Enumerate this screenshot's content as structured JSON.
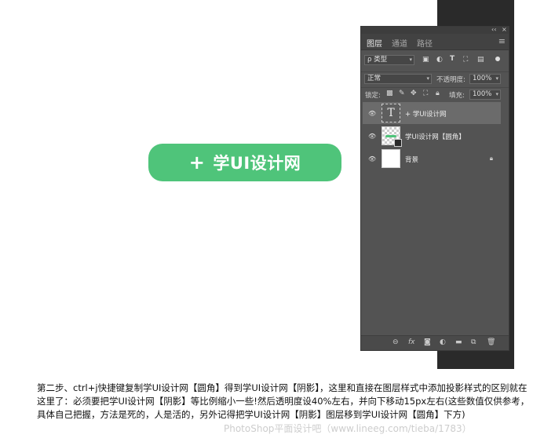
{
  "canvas": {
    "button_plus": "+",
    "button_label": "学UI设计网"
  },
  "panel": {
    "header_controls": [
      "‹‹",
      "×"
    ],
    "tabs": [
      {
        "label": "图层"
      },
      {
        "label": "通道"
      },
      {
        "label": "路径"
      }
    ],
    "menu_icon": "≡",
    "filter": {
      "select_value": "ρ 类型",
      "icons": [
        "image-filter-icon",
        "adjustment-filter-icon",
        "type-filter-icon",
        "shape-filter-icon",
        "smartobject-filter-icon"
      ],
      "filter_toggle": "filter-toggle-icon"
    },
    "blend": {
      "mode": "正常",
      "opacity_label": "不透明度:",
      "opacity_value": "100%"
    },
    "lock": {
      "label": "锁定:",
      "fill_label": "填充:",
      "fill_value": "100%"
    },
    "layers": [
      {
        "name": "+ 学UI设计网",
        "thumb": "T",
        "selected": true
      },
      {
        "name": "学UI设计网【圆角】",
        "selected": false
      },
      {
        "name": "背景",
        "selected": false,
        "locked": true
      }
    ],
    "bottom_icons": [
      "link-icon",
      "fx-icon",
      "mask-icon",
      "adjustment-icon",
      "folder-icon",
      "new-layer-icon",
      "trash-icon"
    ]
  },
  "caption": "第二步、ctrl+j快捷键复制学UI设计网【圆角】得到学UI设计网【阴影】，这里和直接在图层样式中添加投影样式的区别就在这里了：必须要把学UI设计网【阴影】等比例缩小一些!然后透明度设40%左右，并向下移动15px左右(这些数值仅供参考，具体自己把握，方法是死的，人是活的，另外记得把学UI设计网【阴影】图层移到学UI设计网【圆角】下方)",
  "watermark": "PhotoShop平面设计吧（www.lineeg.com/tieba/1783）",
  "colors": {
    "accent_green": "#4fc47a",
    "panel_bg": "#535353"
  }
}
